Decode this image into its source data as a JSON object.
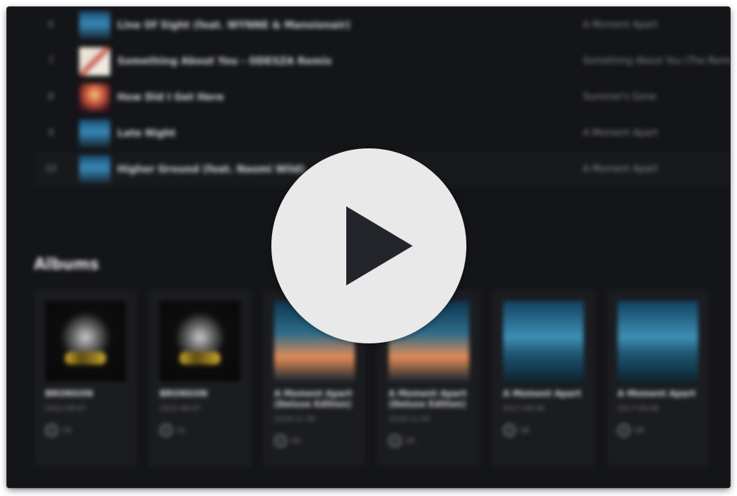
{
  "tracks": [
    {
      "num": "6",
      "title": "Line Of Sight (feat. WYNNE & Mansionair)",
      "album": "A Moment Apart",
      "art": "art-sky"
    },
    {
      "num": "7",
      "title": "Something About You - ODESZA Remix",
      "album": "Something About You (The Remixes)",
      "art": "art-v"
    },
    {
      "num": "8",
      "title": "How Did I Get Here",
      "album": "Summer's Gone",
      "art": "art-sunset"
    },
    {
      "num": "9",
      "title": "Late Night",
      "album": "A Moment Apart",
      "art": "art-sky"
    },
    {
      "num": "10",
      "title": "Higher Ground (feat. Naomi Wild)",
      "album": "A Moment Apart",
      "art": "art-sky"
    }
  ],
  "albums_heading": "Albums",
  "albums": [
    {
      "title": "BRONSON",
      "date": "2022-08-07",
      "tracks": "14",
      "cover": "cover-dark"
    },
    {
      "title": "BRONSON",
      "date": "2022-08-07",
      "tracks": "11",
      "cover": "cover-dark"
    },
    {
      "title": "A Moment Apart (Deluxe Edition)",
      "date": "2018-11-30",
      "tracks": "24",
      "cover": "cover-dusk"
    },
    {
      "title": "A Moment Apart (Deluxe Edition)",
      "date": "2018-11-30",
      "tracks": "24",
      "cover": "cover-dusk"
    },
    {
      "title": "A Moment Apart",
      "date": "2017-09-08",
      "tracks": "16",
      "cover": "cover-ocean"
    },
    {
      "title": "A Moment Apart",
      "date": "2017-09-08",
      "tracks": "16",
      "cover": "cover-ocean"
    }
  ],
  "colors": {
    "background": "#141518",
    "card": "#1b1c20",
    "overlay": "#e9e9e9",
    "play_glyph": "#23252a"
  },
  "overlay_icon": "play-icon"
}
